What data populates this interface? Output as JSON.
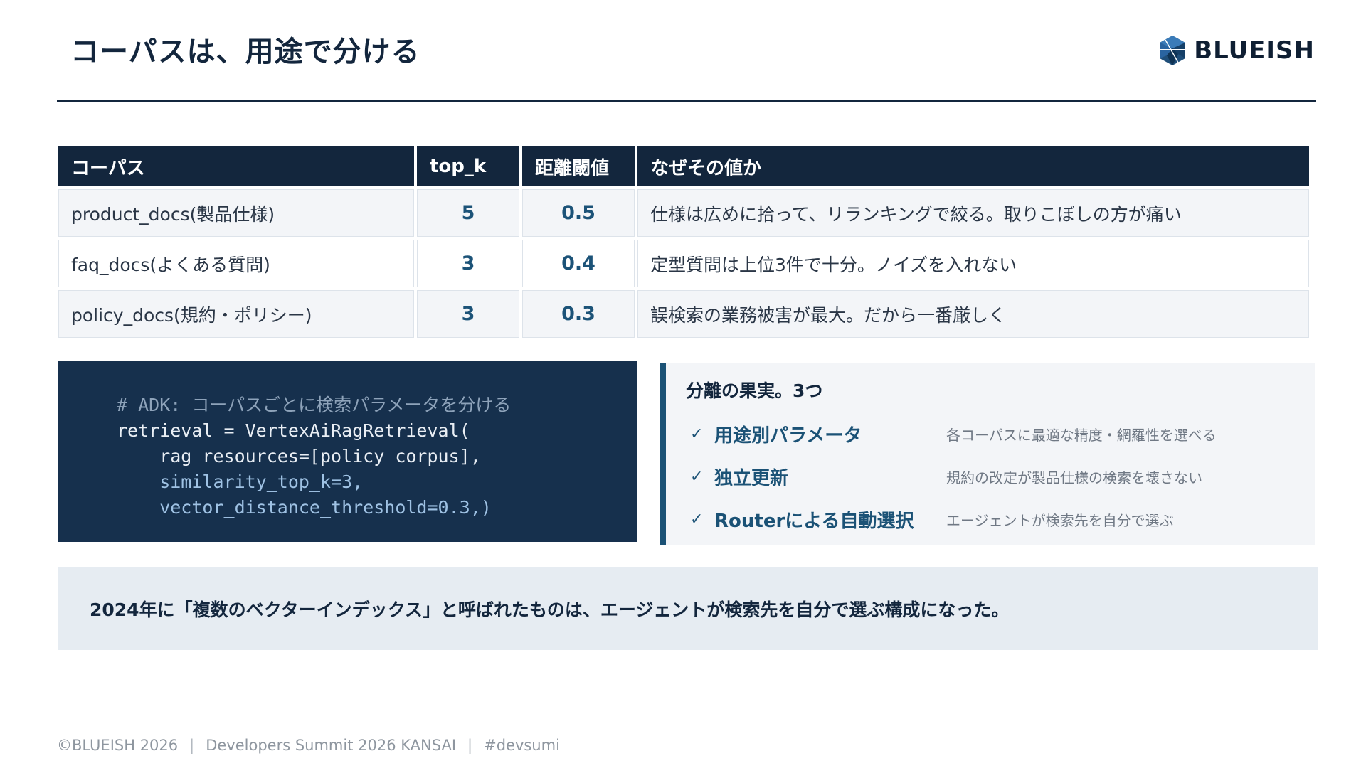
{
  "header": {
    "title": "コーパスは、用途で分ける",
    "logo_text": "BLUEISH"
  },
  "table": {
    "headers": [
      "コーパス",
      "top_k",
      "距離閾値",
      "なぜその値か"
    ],
    "rows": [
      {
        "corpus": "product_docs(製品仕様)",
        "top_k": "5",
        "distance": "0.5",
        "reason": "仕様は広めに拾って、リランキングで絞る。取りこぼしの方が痛い"
      },
      {
        "corpus": "faq_docs(よくある質問)",
        "top_k": "3",
        "distance": "0.4",
        "reason": "定型質問は上位3件で十分。ノイズを入れない"
      },
      {
        "corpus": "policy_docs(規約・ポリシー)",
        "top_k": "3",
        "distance": "0.3",
        "reason": "誤検索の業務被害が最大。だから一番厳しく"
      }
    ]
  },
  "code": {
    "lines": [
      "# ADK: コーパスごとに検索パラメータを分ける",
      "retrieval = VertexAiRagRetrieval(",
      "    rag_resources=[policy_corpus],",
      "    similarity_top_k=3,",
      "    vector_distance_threshold=0.3,)"
    ]
  },
  "panel": {
    "title": "分離の果実。3つ",
    "items": [
      {
        "label": "用途別パラメータ",
        "desc": "各コーパスに最適な精度・網羅性を選べる"
      },
      {
        "label": "独立更新",
        "desc": "規約の改定が製品仕様の検索を壊さない"
      },
      {
        "label": "Routerによる自動選択",
        "desc": "エージェントが検索先を自分で選ぶ"
      }
    ],
    "check_glyph": "✓"
  },
  "conclusion": "2024年に「複数のベクターインデックス」と呼ばれたものは、エージェントが検索先を自分で選ぶ構成になった。",
  "footer": {
    "copyright": "©BLUEISH 2026",
    "event": "Developers Summit 2026 KANSAI",
    "hashtag": "#devsumi",
    "separator": "|"
  },
  "colors": {
    "navy": "#13263d",
    "accent": "#1b5276",
    "code_bg": "#16304d",
    "panel_bg": "#f3f5f8",
    "conclusion_bg": "#e6ecf2"
  }
}
